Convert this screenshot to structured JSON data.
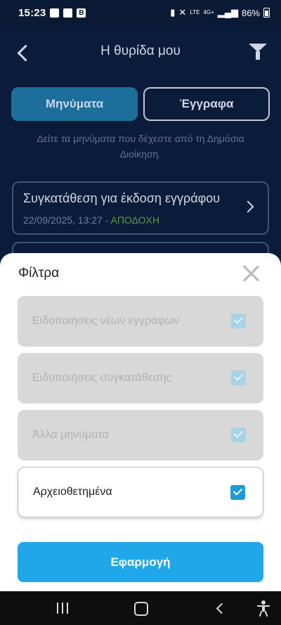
{
  "status_bar": {
    "time": "15:23",
    "left_icons": [
      "gallery-icon",
      "youtube-icon",
      "b-app-icon"
    ],
    "b_badge": "B",
    "network_label": "4G+",
    "lte_label": "LTE",
    "battery_percent": "86%"
  },
  "header": {
    "title": "Η θυρίδα μου"
  },
  "tabs": [
    {
      "label": "Μηνύματα",
      "active": true
    },
    {
      "label": "Έγγραφα",
      "active": false
    }
  ],
  "subtitle": "Δείτε τα μηνύματα που δέχεστε από τη Δημόσια Διοίκηση.",
  "messages": [
    {
      "title": "Συγκατάθεση για έκδοση εγγράφου",
      "date": "22/09/2025, 13:27 -",
      "status": "ΑΠΟΔΟΧΗ"
    }
  ],
  "filters_sheet": {
    "title": "Φίλτρα",
    "options": [
      {
        "label": "Ειδοποιήσεις νέων εγγράφων",
        "checked": true,
        "enabled": false
      },
      {
        "label": "Ειδοποιήσεις συγκατάθεσης",
        "checked": true,
        "enabled": false
      },
      {
        "label": "Άλλα μηνύματα",
        "checked": true,
        "enabled": false
      },
      {
        "label": "Αρχειοθετημένα",
        "checked": true,
        "enabled": true
      }
    ],
    "apply_label": "Εφαρμογή"
  },
  "colors": {
    "primary": "#1fa7ea",
    "background": "#0b1c3a",
    "status_accept": "#5f9c3f"
  }
}
